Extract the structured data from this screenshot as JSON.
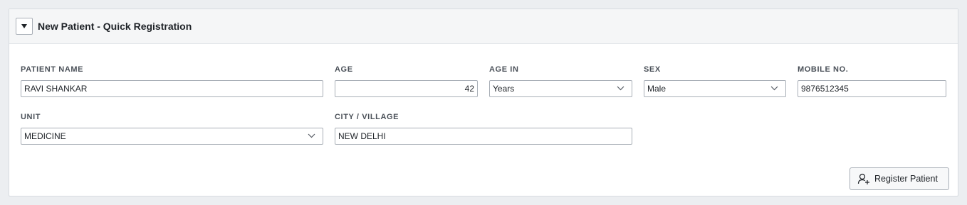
{
  "panel": {
    "title": "New Patient - Quick Registration"
  },
  "fields": {
    "patient_name": {
      "label": "PATIENT NAME",
      "value": "RAVI SHANKAR"
    },
    "age": {
      "label": "AGE",
      "value": "42"
    },
    "age_in": {
      "label": "AGE IN",
      "value": "Years"
    },
    "sex": {
      "label": "SEX",
      "value": "Male"
    },
    "mobile": {
      "label": "MOBILE NO.",
      "value": "9876512345"
    },
    "unit": {
      "label": "UNIT",
      "value": "MEDICINE"
    },
    "city": {
      "label": "CITY / VILLAGE",
      "value": "NEW DELHI"
    }
  },
  "actions": {
    "register_label": "Register Patient"
  },
  "icons": {
    "toggle": "caret-down-icon",
    "register": "add-user-icon",
    "dropdown": "chevron-down-icon"
  }
}
